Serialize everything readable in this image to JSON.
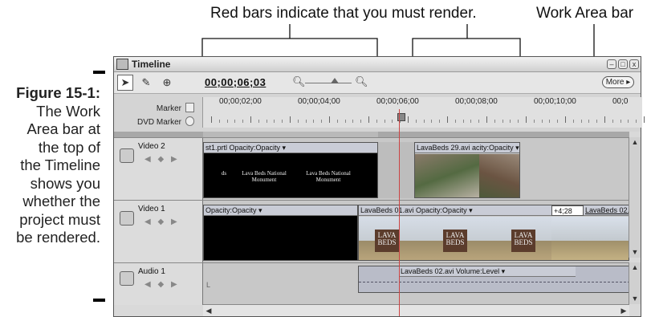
{
  "callouts": {
    "red_bars": "Red bars indicate that you must render.",
    "work_area": "Work Area bar"
  },
  "caption": {
    "figure": "Figure 15-1:",
    "lines": [
      "The Work",
      "Area bar at",
      "the top of",
      "the Timeline",
      "shows you",
      "whether the",
      "project must",
      "be rendered."
    ]
  },
  "window": {
    "title": "Timeline",
    "timecode": "00;00;06;03",
    "more_label": "More ▸",
    "minimize": "–",
    "maximize": "□",
    "close": "x"
  },
  "ruler": {
    "marker_label": "Marker",
    "dvd_marker_label": "DVD Marker",
    "ticks": [
      "00;00;02;00",
      "00;00;04;00",
      "00;00;06;00",
      "00;00;08;00",
      "00;00;10;00",
      "00;0"
    ]
  },
  "tracks": {
    "video2": {
      "name": "Video 2",
      "clip1_label": "st1.prtl  Opacity:Opacity ▾",
      "clip2_label": "LavaBeds 29.avi  acity:Opacity ▾",
      "frame_text_1": "ds",
      "frame_text_2": "Lava Beds National Monument",
      "frame_text_3": "Lava Beds National Monument"
    },
    "video1": {
      "name": "Video 1",
      "clip1_label": "Opacity:Opacity ▾",
      "clip2_label": "LavaBeds 01.avi  Opacity:Opacity ▾",
      "offset": "+4;28",
      "clip3_label": "LavaBeds 02.avi",
      "sign_text": "LAVA BEDS"
    },
    "audio1": {
      "name": "Audio 1",
      "clip_label": "LavaBeds 02.avi  Volume:Level ▾",
      "letter": "L"
    }
  },
  "icons": [
    "selection-tool-icon",
    "razor-tool-icon",
    "snap-icon",
    "zoom-out-icon",
    "zoom-in-icon",
    "marker-icon",
    "dvd-marker-icon",
    "eye-icon",
    "speaker-icon"
  ],
  "colors": {
    "accent_red": "#c44444",
    "work_area": "#a8a8a8"
  }
}
